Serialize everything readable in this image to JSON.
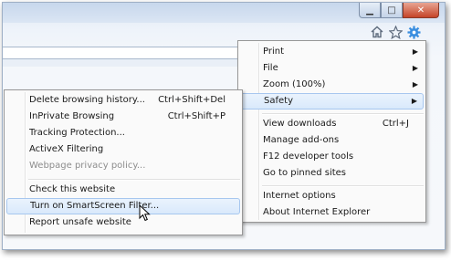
{
  "window": {
    "minimize_glyph": "▁",
    "maximize_glyph": "□",
    "close_glyph": "✕"
  },
  "command_icons": [
    "home-icon",
    "favorites-star-icon",
    "tools-gear-icon"
  ],
  "colors": {
    "accent": "#3a8ee0",
    "highlight_border": "#a7c7ef"
  },
  "main_menu": {
    "items": [
      {
        "label": "Print",
        "has_submenu": true
      },
      {
        "label": "File",
        "has_submenu": true
      },
      {
        "label": "Zoom (100%)",
        "has_submenu": true
      },
      {
        "label": "Safety",
        "has_submenu": true,
        "highlighted": true
      },
      {
        "label": "View downloads",
        "shortcut": "Ctrl+J"
      },
      {
        "label": "Manage add-ons"
      },
      {
        "label": "F12 developer tools"
      },
      {
        "label": "Go to pinned sites"
      },
      {
        "label": "Internet options"
      },
      {
        "label": "About Internet Explorer"
      }
    ],
    "submenu_arrow": "▶"
  },
  "safety_menu": {
    "items": [
      {
        "label": "Delete browsing history...",
        "shortcut": "Ctrl+Shift+Del"
      },
      {
        "label": "InPrivate Browsing",
        "shortcut": "Ctrl+Shift+P"
      },
      {
        "label": "Tracking Protection..."
      },
      {
        "label": "ActiveX Filtering"
      },
      {
        "label": "Webpage privacy policy...",
        "disabled": true
      },
      {
        "label": "Check this website"
      },
      {
        "label": "Turn on SmartScreen Filter...",
        "highlighted": true
      },
      {
        "label": "Report unsafe website"
      }
    ]
  }
}
